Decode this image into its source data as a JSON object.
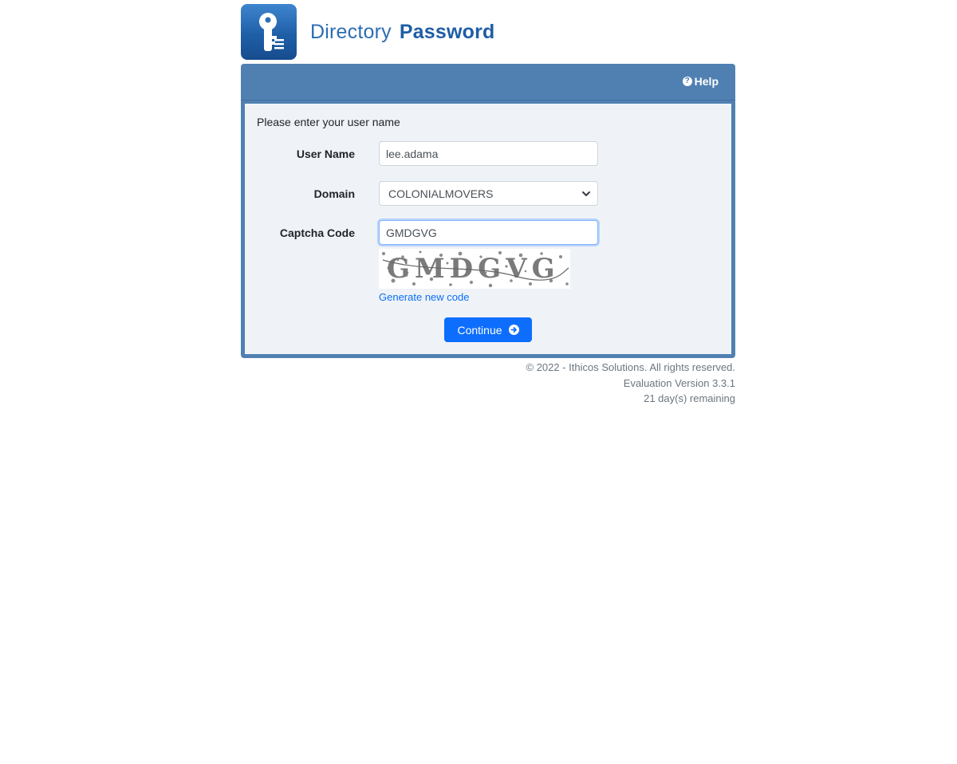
{
  "brand": {
    "name_light": "Directory",
    "name_bold": "Password",
    "logo_icon": "key-icon",
    "colors": {
      "panel": "#5080b2",
      "body": "#eff3f7",
      "primary": "#0d6efd",
      "logo": "#1f5fa8"
    }
  },
  "header": {
    "help_label": "Help",
    "help_icon": "question-circle-icon"
  },
  "form": {
    "intro": "Please enter your user name",
    "username": {
      "label": "User Name",
      "value": "lee.adama"
    },
    "domain": {
      "label": "Domain",
      "selected": "COLONIALMOVERS"
    },
    "captcha": {
      "label": "Captcha Code",
      "value": "GMDGVG",
      "image_text": "GMDGVG",
      "generate_link": "Generate new code"
    },
    "continue_label": "Continue",
    "continue_icon": "arrow-circle-right-icon"
  },
  "footer": {
    "copyright": "© 2022 - Ithicos Solutions. All rights reserved.",
    "version": "Evaluation Version 3.3.1",
    "remaining": "21 day(s) remaining"
  }
}
